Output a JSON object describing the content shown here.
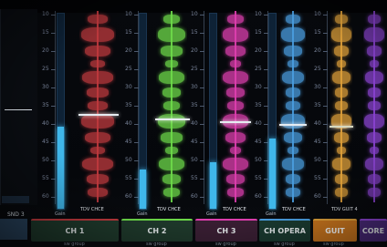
{
  "channels": [
    {
      "name": "CH 1",
      "color": "#c03a3e",
      "button_bg": "#1f3a2c",
      "button_fg": "#e9eef0",
      "wave_label": "TDV CHCE",
      "meter_level": 0.42
    },
    {
      "name": "CH 2",
      "color": "#6edc4a",
      "button_bg": "#1f3a2c",
      "button_fg": "#e9eef0",
      "wave_label": "TDV CHCE",
      "meter_level": 0.2
    },
    {
      "name": "CH 3",
      "color": "#e03fb0",
      "button_bg": "#3a1f34",
      "button_fg": "#e9eef0",
      "wave_label": "TDV CHCE",
      "meter_level": 0.24
    },
    {
      "name": "CH OPERA",
      "color": "#4a9ee0",
      "button_bg": "#1a3a30",
      "button_fg": "#e9eef0",
      "wave_label": "TDV CHCE",
      "meter_level": 0.36
    },
    {
      "name": "GUIT",
      "color": "#e0a13a",
      "button_bg": "#c9751e",
      "button_fg": "#ffffff",
      "wave_label": "TDV GUIT 4",
      "meter_level": 0.0
    },
    {
      "name": "CORE",
      "color": "#8a43d0",
      "button_bg": "#4a2a7a",
      "button_fg": "#e9eef0",
      "wave_label": "TDV CHCE",
      "meter_level": 0.0
    }
  ],
  "left_channel": {
    "name": "SND 3",
    "sub": "Bus"
  },
  "scale_ticks": [
    "10",
    "15",
    "20",
    "25",
    "30",
    "35",
    "40",
    "45",
    "50",
    "55",
    "60"
  ],
  "meter_caption": "Gain",
  "sub_captions": [
    "sw group",
    "sw group",
    "sw group",
    "sw group",
    "sw group",
    "sw group"
  ],
  "colors": {
    "meter": "#3fb7ea",
    "background": "#05070b"
  }
}
